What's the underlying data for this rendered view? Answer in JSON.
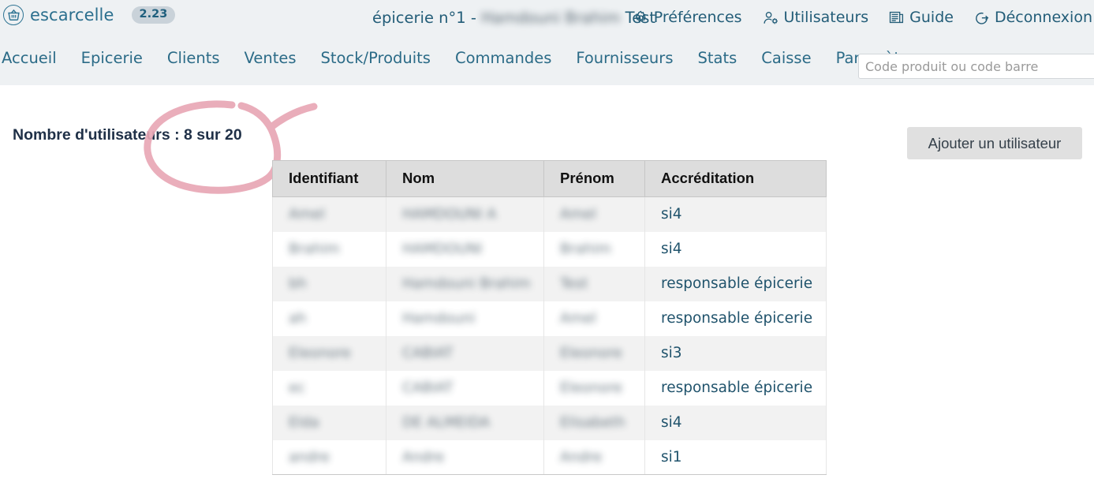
{
  "header": {
    "brand": {
      "name": "escarcelle",
      "version_badge": "2.23",
      "logo_icon": "shopping-basket-icon"
    },
    "shop_title_prefix": "épicerie n°1 - ",
    "shop_title_redacted": "Hamdouni Brahim",
    "shop_title_suffix": " Test",
    "links": [
      {
        "label": "Préférences",
        "icon": "gear-icon"
      },
      {
        "label": "Utilisateurs",
        "icon": "user-gear-icon"
      },
      {
        "label": "Guide",
        "icon": "book-icon"
      },
      {
        "label": "Déconnexion",
        "icon": "logout-icon"
      }
    ]
  },
  "nav": {
    "items": [
      {
        "label": "Accueil"
      },
      {
        "label": "Epicerie"
      },
      {
        "label": "Clients"
      },
      {
        "label": "Ventes"
      },
      {
        "label": "Stock/Produits"
      },
      {
        "label": "Commandes"
      },
      {
        "label": "Fournisseurs"
      },
      {
        "label": "Stats"
      },
      {
        "label": "Caisse"
      },
      {
        "label": "Paramètres"
      }
    ]
  },
  "search": {
    "placeholder": "Code produit ou code barre",
    "value": ""
  },
  "main": {
    "page_heading": "Nombre d'utilisateurs : 8 sur 20",
    "user_count": 8,
    "user_limit": 20,
    "add_user_label": "Ajouter un utilisateur",
    "annotation": {
      "type": "hand-drawn-ellipse",
      "color": "#e8a7b5"
    },
    "table": {
      "columns": [
        "Identifiant",
        "Nom",
        "Prénom",
        "Accréditation"
      ],
      "rows": [
        {
          "identifiant": "Amel",
          "nom": "HAMDOUNI A",
          "prenom": "Amel",
          "accreditation": "si4",
          "redacted": true
        },
        {
          "identifiant": "Brahim",
          "nom": "HAMDOUNI",
          "prenom": "Brahim",
          "accreditation": "si4",
          "redacted": true
        },
        {
          "identifiant": "bh",
          "nom": "Hamdouni Brahim",
          "prenom": "Test",
          "accreditation": "responsable épicerie",
          "redacted": true
        },
        {
          "identifiant": "ah",
          "nom": "Hamdouni",
          "prenom": "Amel",
          "accreditation": "responsable épicerie",
          "redacted": true
        },
        {
          "identifiant": "Eleonore",
          "nom": "CABIAT",
          "prenom": "Eleonore",
          "accreditation": "si3",
          "redacted": true
        },
        {
          "identifiant": "ec",
          "nom": "CABIAT",
          "prenom": "Eleonore",
          "accreditation": "responsable épicerie",
          "redacted": true
        },
        {
          "identifiant": "Elda",
          "nom": "DE ALMEIDA",
          "prenom": "Elisabeth",
          "accreditation": "si4",
          "redacted": true
        },
        {
          "identifiant": "andre",
          "nom": "Andre",
          "prenom": "Andre",
          "accreditation": "si1",
          "redacted": true
        }
      ]
    }
  },
  "colors": {
    "header_bg": "#eef1f3",
    "brand_blue": "#2b6f8e",
    "nav_blue": "#2b6b87",
    "table_header_bg": "#dddddd",
    "row_stripe": "#f2f2f2",
    "annotation_pink": "#e8a7b5",
    "button_bg": "#e0e0e0"
  }
}
